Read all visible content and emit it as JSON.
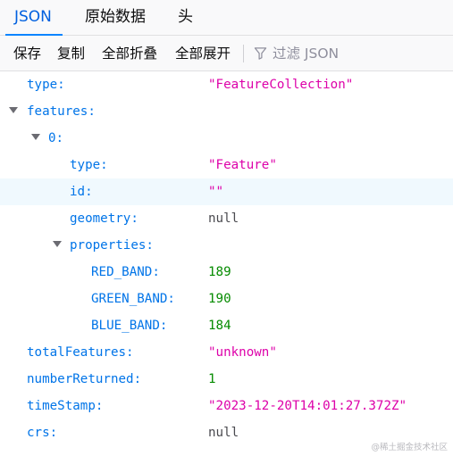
{
  "tabs": [
    {
      "label": "JSON",
      "active": true
    },
    {
      "label": "原始数据",
      "active": false
    },
    {
      "label": "头",
      "active": false
    }
  ],
  "toolbar": {
    "save_label": "保存",
    "copy_label": "复制",
    "collapse_all_label": "全部折叠",
    "expand_all_label": "全部展开",
    "filter_placeholder": "过滤 JSON",
    "filter_icon": "funnel-icon"
  },
  "tree": {
    "type": {
      "key": "type:",
      "value": "\"FeatureCollection\""
    },
    "features": {
      "key": "features:"
    },
    "feature_0": {
      "key": "0:"
    },
    "f_type": {
      "key": "type:",
      "value": "\"Feature\""
    },
    "f_id": {
      "key": "id:",
      "value": "\"\""
    },
    "f_geometry": {
      "key": "geometry:",
      "value": "null"
    },
    "f_properties": {
      "key": "properties:"
    },
    "red_band": {
      "key": "RED_BAND:",
      "value": "189"
    },
    "green_band": {
      "key": "GREEN_BAND:",
      "value": "190"
    },
    "blue_band": {
      "key": "BLUE_BAND:",
      "value": "184"
    },
    "totalFeatures": {
      "key": "totalFeatures:",
      "value": "\"unknown\""
    },
    "numberReturned": {
      "key": "numberReturned:",
      "value": "1"
    },
    "timeStamp": {
      "key": "timeStamp:",
      "value": "\"2023-12-20T14:01:27.372Z\""
    },
    "crs": {
      "key": "crs:",
      "value": "null"
    }
  },
  "colors": {
    "key": "#0074e8",
    "string": "#dd00a9",
    "number": "#058b00",
    "null": "#4a4a4f",
    "active_tab": "#0060df",
    "highlight_row": "#f0f9fe"
  },
  "watermark": "@稀土掘金技术社区"
}
